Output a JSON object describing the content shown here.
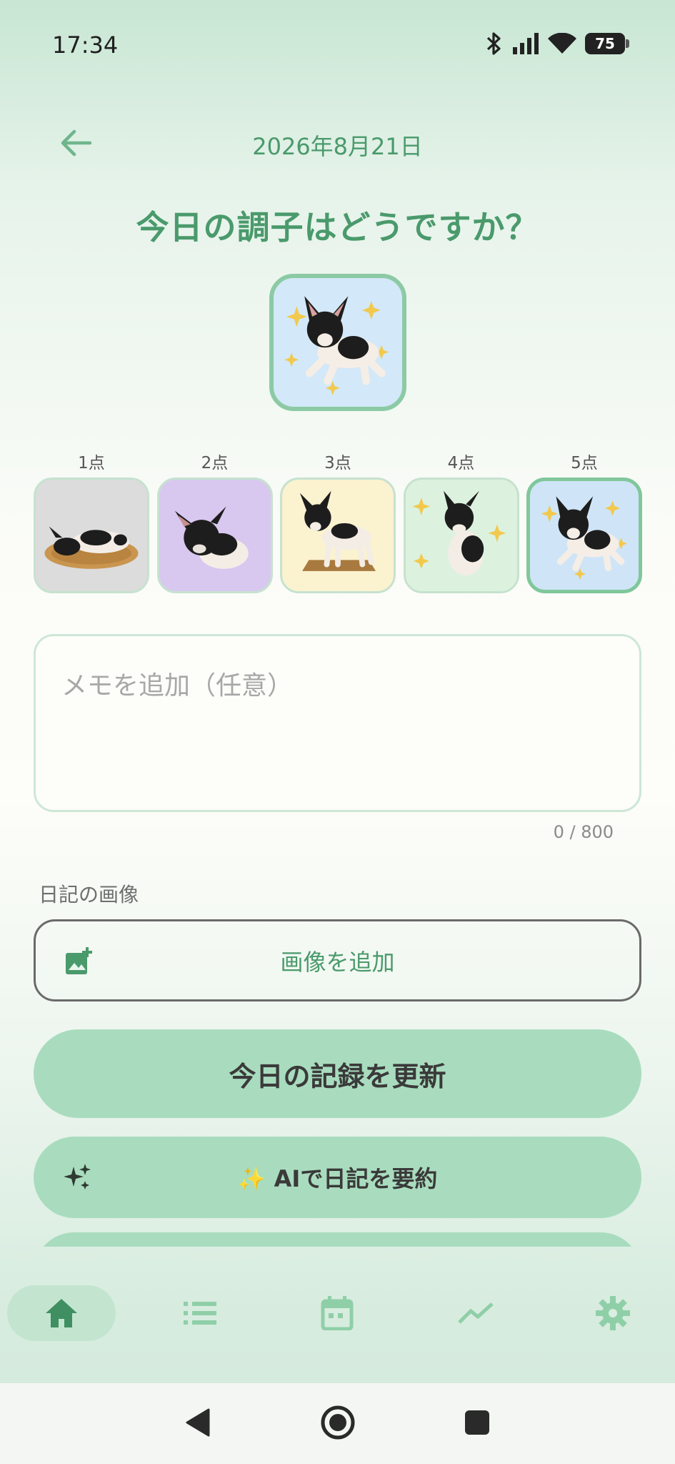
{
  "status_bar": {
    "time": "17:34",
    "battery": "75"
  },
  "header": {
    "date": "2026年8月21日"
  },
  "question": "今日の調子はどうですか？",
  "scores": [
    {
      "label": "1点",
      "mood": "sleeping"
    },
    {
      "label": "2点",
      "mood": "sad"
    },
    {
      "label": "3点",
      "mood": "standing"
    },
    {
      "label": "4点",
      "mood": "happy"
    },
    {
      "label": "5点",
      "mood": "jumping"
    }
  ],
  "selected_score": 5,
  "memo": {
    "placeholder": "メモを追加（任意）",
    "value": "",
    "char_count": "0 / 800"
  },
  "images": {
    "section_label": "日記の画像",
    "add_button": "画像を追加"
  },
  "actions": {
    "update": "今日の記録を更新",
    "ai_summary": "✨ AIで日記を要約"
  },
  "nav": [
    "home-icon",
    "list-icon",
    "calendar-icon",
    "chart-icon",
    "gear-icon"
  ],
  "colors": {
    "accent": "#4a9a6c",
    "button": "#a9dcbe",
    "selected_border": "#80c79c"
  }
}
